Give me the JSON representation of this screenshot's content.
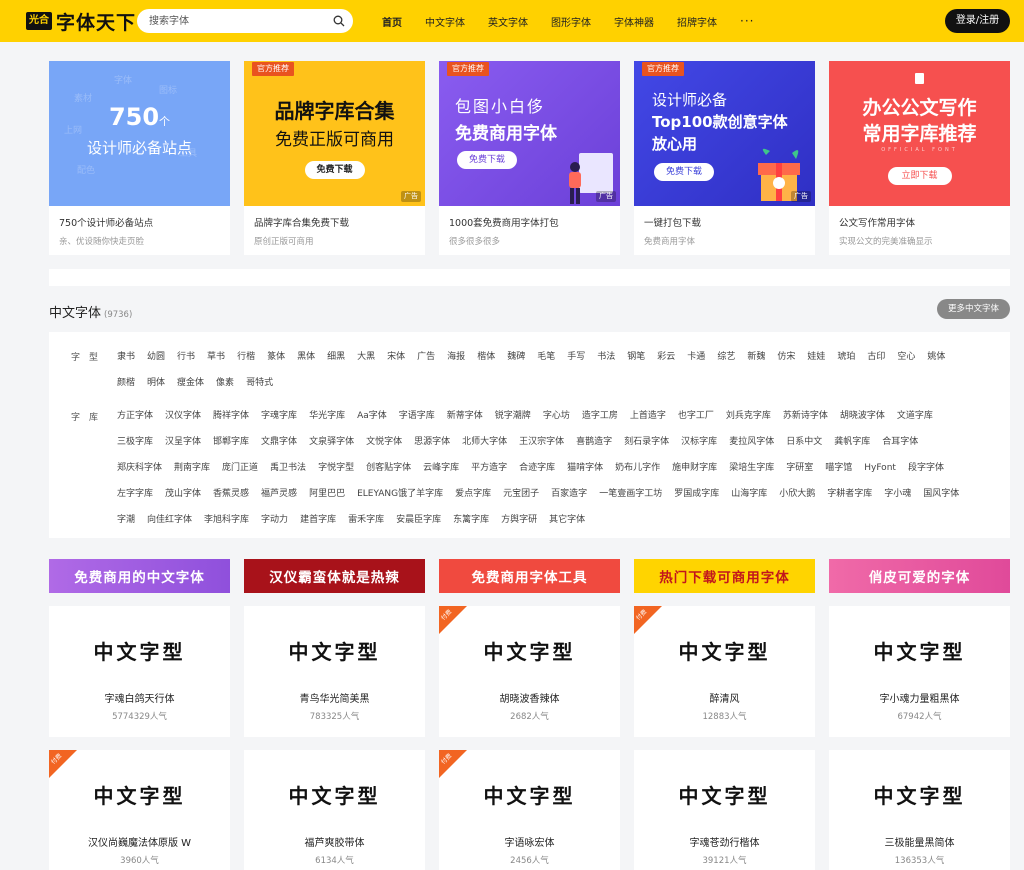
{
  "header": {
    "logo_badge": "光合",
    "logo_text": "字体天下",
    "search_placeholder": "搜索字体",
    "nav": [
      "首页",
      "中文字体",
      "英文字体",
      "图形字体",
      "字体神器",
      "招牌字体"
    ],
    "nav_more": "···",
    "login": "登录/注册",
    "brand_color": "#ffd100"
  },
  "banners": [
    {
      "head1": "750",
      "head1_suffix": "个",
      "head2": "设计师必备站点",
      "title": "750个设计师必备站点",
      "sub": "亲、优设随你快走页脸",
      "bg": "#78a6f7"
    },
    {
      "tag": "官方推荐",
      "head1": "品牌字库合集",
      "head2": "免费正版可商用",
      "button": "免费下载",
      "ad": "广告",
      "title": "品牌字库合集免费下载",
      "sub": "原创正版可商用",
      "bg": "#ffc21a"
    },
    {
      "tag": "官方推荐",
      "head1": "包图小白侈",
      "head2": "免费商用字体",
      "button": "免费下载",
      "ad": "广告",
      "title": "1000套免费商用字体打包",
      "sub": "很多很多很多",
      "bg": "#7b4fe0"
    },
    {
      "tag": "官方推荐",
      "head1": "设计师必备",
      "head2": "Top100款创意字体",
      "head3": "放心用",
      "button": "免费下载",
      "ad": "广告",
      "title": "一键打包下载",
      "sub": "免费商用字体",
      "bg": "#3a3fd9"
    },
    {
      "head1": "办公公文写作",
      "head2": "常用字库推荐",
      "small": "OFFICIAL FONT",
      "button": "立即下载",
      "title": "公文写作常用字体",
      "sub": "实现公文的完美准确显示",
      "bg": "#f6504f"
    }
  ],
  "section": {
    "title": "中文字体",
    "count": "(9736)",
    "more": "更多中文字体"
  },
  "filters": {
    "type_label": "字型",
    "types": [
      "隶书",
      "幼圆",
      "行书",
      "草书",
      "行楷",
      "篆体",
      "黑体",
      "细黑",
      "大黑",
      "宋体",
      "广告",
      "海报",
      "楷体",
      "魏碑",
      "毛笔",
      "手写",
      "书法",
      "钢笔",
      "彩云",
      "卡通",
      "综艺",
      "新魏",
      "仿宋",
      "娃娃",
      "琥珀",
      "古印",
      "空心",
      "姚体",
      "颜楷",
      "明体",
      "瘦金体",
      "像素",
      "哥特式"
    ],
    "lib_label": "字库",
    "libs": [
      "方正字体",
      "汉仪字体",
      "腾祥字体",
      "字魂字库",
      "华光字库",
      "Aa字体",
      "字语字库",
      "新蒂字体",
      "锐字潮牌",
      "字心坊",
      "造字工房",
      "上首造字",
      "也字工厂",
      "刘兵克字库",
      "苏新诗字体",
      "胡晓波字体",
      "文道字库",
      "三极字库",
      "汉呈字体",
      "邯郸字库",
      "文鼎字体",
      "文泉驿字体",
      "文悦字体",
      "思源字体",
      "北师大字体",
      "王汉宗字体",
      "喜鹊造字",
      "刻石录字体",
      "汉标字库",
      "麦拉风字体",
      "日系中文",
      "龚帆字库",
      "合耳字体",
      "郑庆科字体",
      "荆南字库",
      "庞门正道",
      "禹卫书法",
      "字悦字型",
      "创客贴字体",
      "云峰字库",
      "平方造字",
      "合迹字库",
      "猫啃字体",
      "奶布儿字作",
      "施申财字库",
      "梁培生字库",
      "字研室",
      "喵字馆",
      "HyFont",
      "段字字体",
      "左字字库",
      "茂山字体",
      "香蕉灵感",
      "福芦灵感",
      "阿里巴巴",
      "ELEYANG饿了羊字库",
      "爱点字库",
      "元宝团子",
      "百家造字",
      "一笔壹画字工坊",
      "罗国成字库",
      "山海字库",
      "小欣大鹅",
      "字耕者字库",
      "字小魂",
      "国风字体",
      "字潮",
      "向佳红字体",
      "李旭科字库",
      "字动力",
      "建首字库",
      "雷禾字库",
      "安晨臣字库",
      "东篱字库",
      "方舆字研",
      "其它字体"
    ]
  },
  "categories": [
    {
      "label": "免费商用的中文字体",
      "bg": "#a45fe0"
    },
    {
      "label": "汉仪霸蛮体就是热辣",
      "bg": "#a8121a"
    },
    {
      "label": "免费商用字体工具",
      "bg": "#f04a3f"
    },
    {
      "label": "热门下载可商用字体",
      "bg": "#ffd400"
    },
    {
      "label": "俏皮可爱的字体",
      "bg": "#e75ba8"
    }
  ],
  "paid_label": "付费",
  "fonts": [
    {
      "sample": "中文字型",
      "name": "字魂白鸽天行体",
      "pop": "5774329人气",
      "paid": false
    },
    {
      "sample": "中文字型",
      "name": "青鸟华光简美黑",
      "pop": "783325人气",
      "paid": false
    },
    {
      "sample": "中文字型",
      "name": "胡晓波香辣体",
      "pop": "2682人气",
      "paid": true
    },
    {
      "sample": "中文字型",
      "name": "醉清风",
      "pop": "12883人气",
      "paid": true
    },
    {
      "sample": "中文字型",
      "name": "字小魂力量粗黑体",
      "pop": "67942人气",
      "paid": false
    },
    {
      "sample": "中文字型",
      "name": "汉仪尚巍魔法体原版 W",
      "pop": "3960人气",
      "paid": true
    },
    {
      "sample": "中文字型",
      "name": "福芦爽胶带体",
      "pop": "6134人气",
      "paid": false
    },
    {
      "sample": "中文字型",
      "name": "字语咏宏体",
      "pop": "2456人气",
      "paid": true
    },
    {
      "sample": "中文字型",
      "name": "字魂苍劲行楷体",
      "pop": "39121人气",
      "paid": false
    },
    {
      "sample": "中文字型",
      "name": "三极能量黑简体",
      "pop": "136353人气",
      "paid": false
    }
  ]
}
